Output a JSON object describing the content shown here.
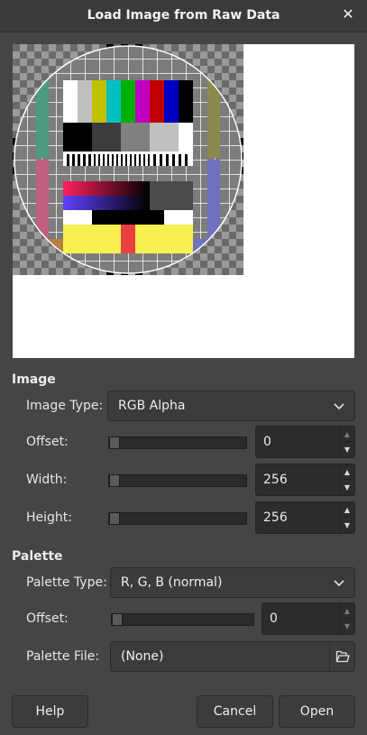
{
  "window": {
    "title": "Load Image from Raw Data"
  },
  "image_section": {
    "heading": "Image",
    "image_type": {
      "label": "Image Type:",
      "value": "RGB Alpha"
    },
    "offset": {
      "label": "Offset:",
      "value": "0"
    },
    "width": {
      "label": "Width:",
      "value": "256"
    },
    "height": {
      "label": "Height:",
      "value": "256"
    }
  },
  "palette_section": {
    "heading": "Palette",
    "palette_type": {
      "label": "Palette Type:",
      "value": "R, G, B (normal)"
    },
    "offset": {
      "label": "Offset:",
      "value": "0"
    },
    "palette_file": {
      "label": "Palette File:",
      "value": "(None)"
    }
  },
  "buttons": {
    "help": "Help",
    "cancel": "Cancel",
    "open": "Open"
  },
  "icons": {
    "close": "close-icon",
    "dropdown": "chevron-down-icon",
    "spin_up": "spin-up-icon",
    "spin_down": "spin-down-icon",
    "file": "open-file-icon"
  },
  "colors": {
    "dialog_bg": "#454545",
    "titlebar_bg": "#3a3a3a",
    "field_bg": "#2c2c2c"
  }
}
